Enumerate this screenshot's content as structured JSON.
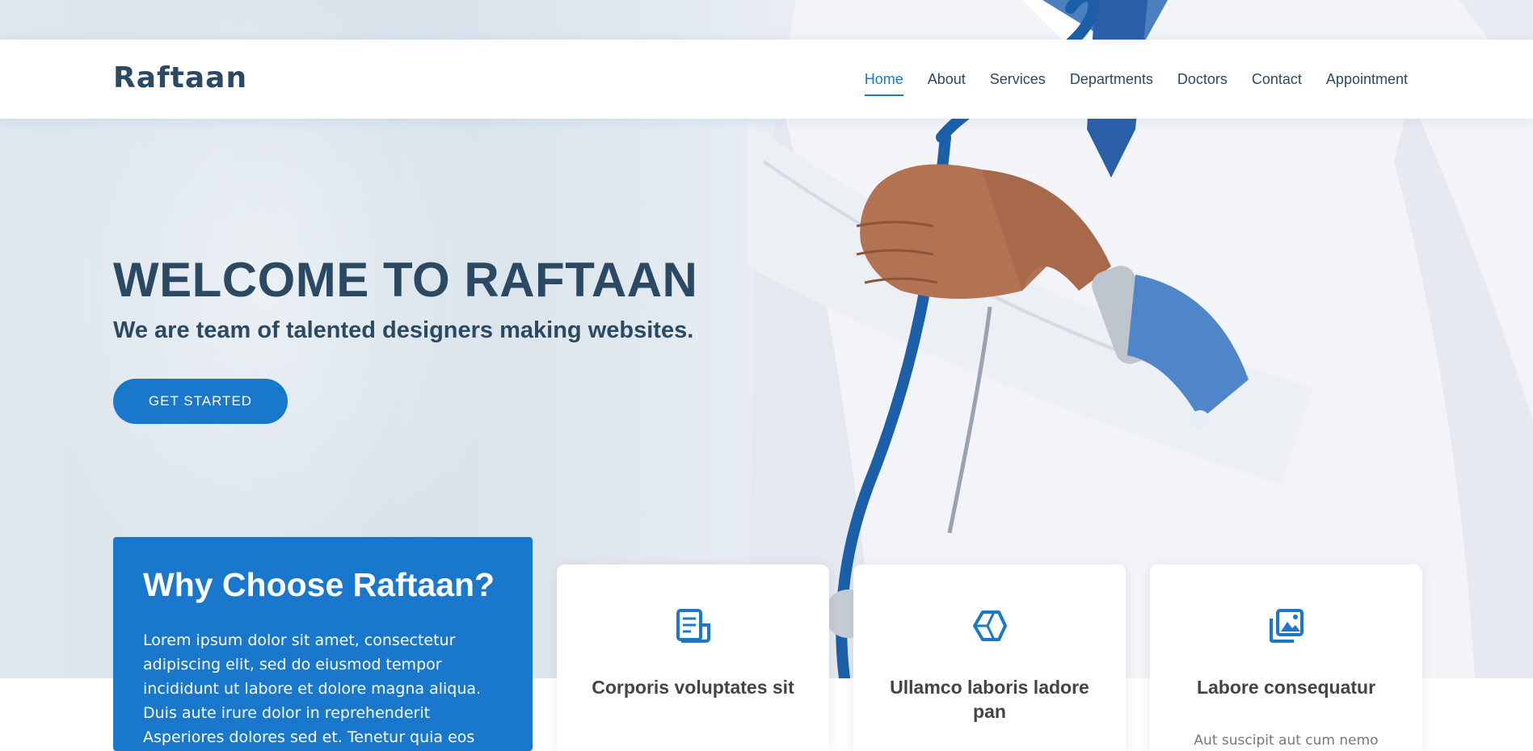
{
  "header": {
    "logo": "Raftaan",
    "nav": [
      {
        "label": "Home",
        "active": true
      },
      {
        "label": "About"
      },
      {
        "label": "Services"
      },
      {
        "label": "Departments"
      },
      {
        "label": "Doctors"
      },
      {
        "label": "Contact"
      },
      {
        "label": "Appointment"
      }
    ]
  },
  "hero": {
    "title": "WELCOME TO RAFTAAN",
    "subtitle": "We are team of talented designers making websites.",
    "cta_label": "GET STARTED"
  },
  "why": {
    "title": "Why Choose Raftaan?",
    "text": "Lorem ipsum dolor sit amet, consectetur adipiscing elit, sed do eiusmod tempor incididunt ut labore et dolore magna aliqua. Duis aute irure dolor in reprehenderit Asperiores dolores sed et. Tenetur quia eos"
  },
  "cards": [
    {
      "icon": "receipt-icon",
      "title": "Corporis voluptates sit",
      "text": ""
    },
    {
      "icon": "cube-icon",
      "title": "Ullamco laboris ladore pan",
      "text": ""
    },
    {
      "icon": "images-icon",
      "title": "Labore consequatur",
      "text": "Aut suscipit aut cum nemo"
    }
  ],
  "colors": {
    "accent": "#1977cc",
    "heading": "#2c4964",
    "card_title": "#444444"
  }
}
